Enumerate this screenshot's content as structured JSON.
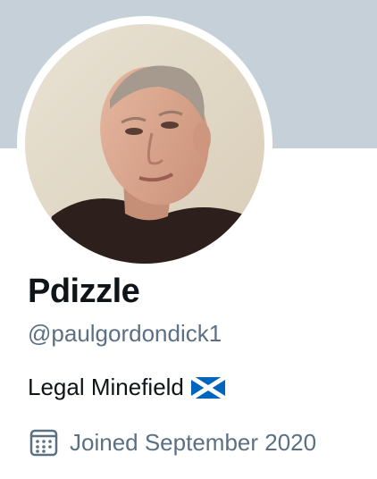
{
  "profile": {
    "display_name": "Pdizzle",
    "handle": "@paulgordondick1",
    "bio": "Legal Minefield",
    "bio_emoji": "scotland-flag-icon",
    "joined": "Joined September 2020"
  },
  "icons": {
    "joined": "calendar-icon"
  },
  "colors": {
    "banner": "#c5d0d9",
    "secondary_text": "#5b7083",
    "primary_text": "#0f1419",
    "flag_blue": "#0065bd"
  }
}
